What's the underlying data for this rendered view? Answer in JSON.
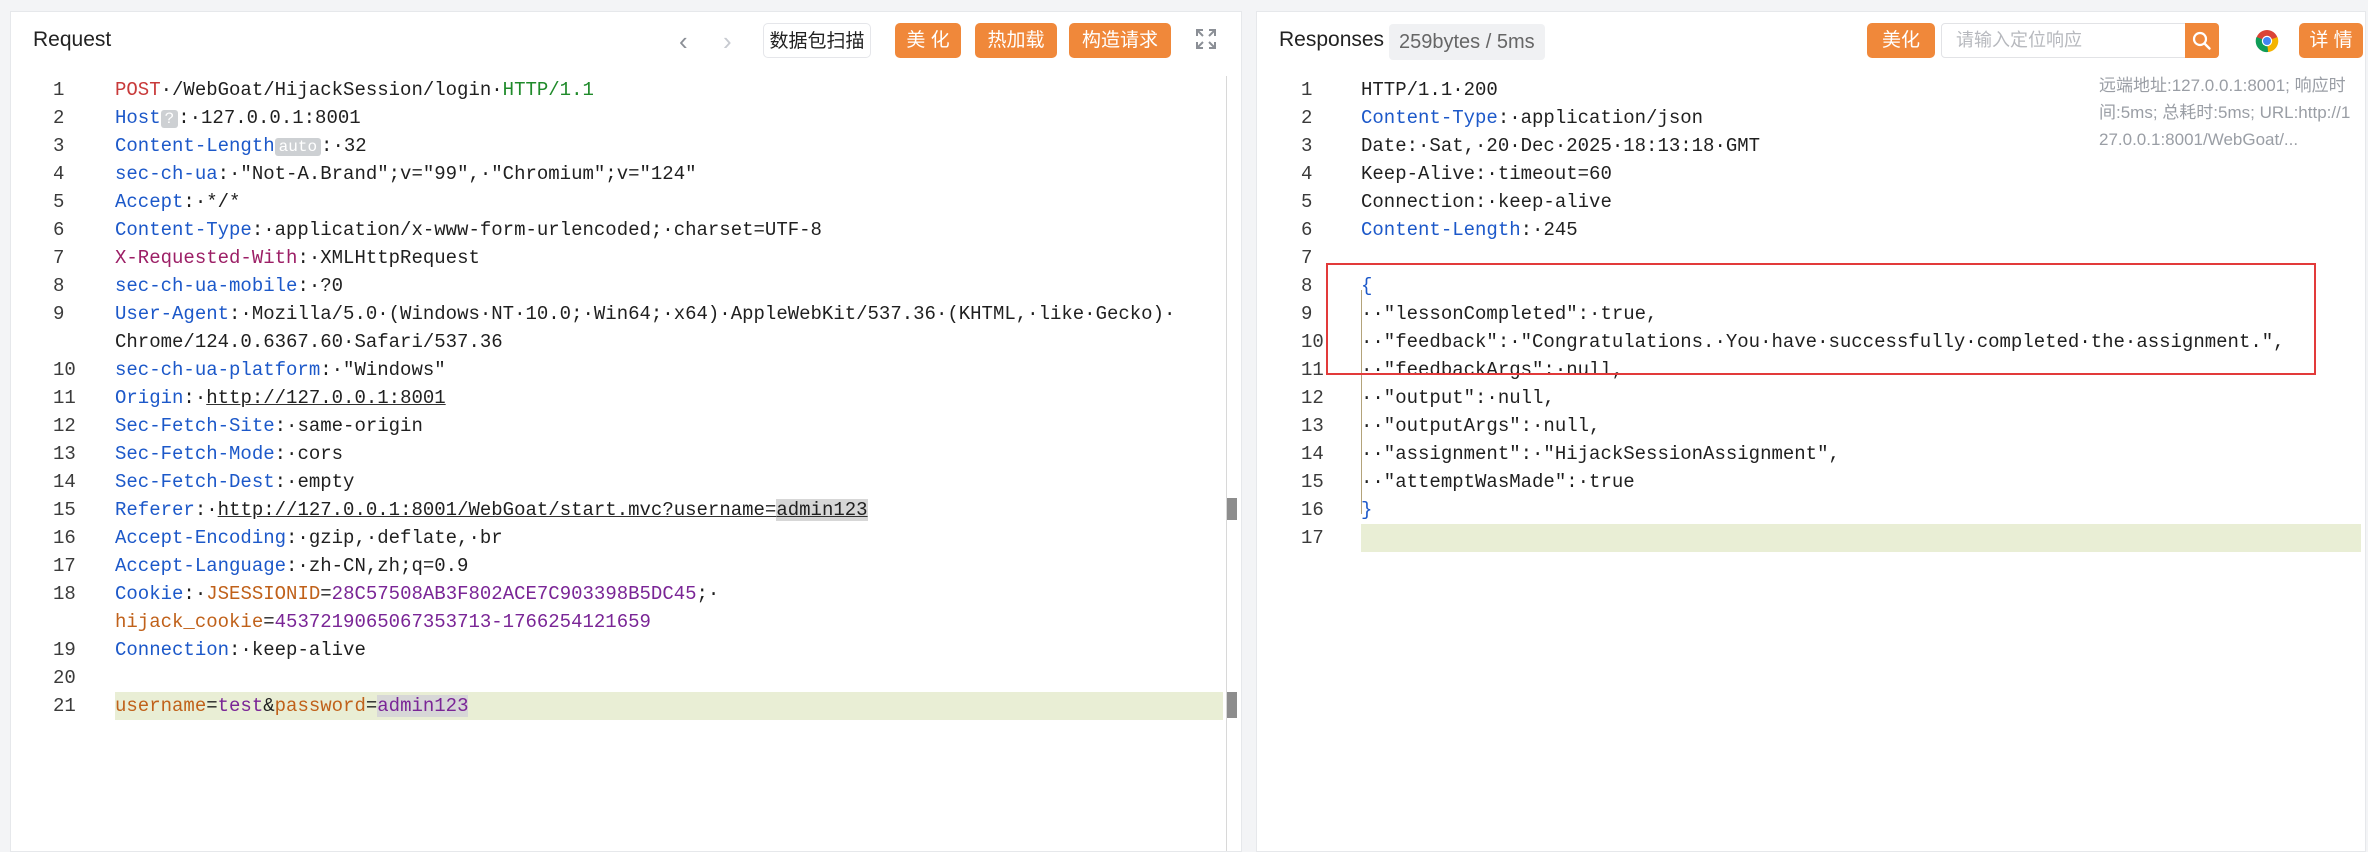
{
  "request": {
    "title": "Request",
    "scan_label": "数据包扫描",
    "beautify_label": "美 化",
    "hotload_label": "热加载",
    "construct_label": "构造请求",
    "lines": [
      {
        "n": "1",
        "parts": [
          [
            "k-red",
            "POST"
          ],
          [
            "",
            "·/WebGoat/HijackSession/login·"
          ],
          [
            "k-green",
            "HTTP/1.1"
          ]
        ]
      },
      {
        "n": "2",
        "parts": [
          [
            "k-blue",
            "Host"
          ],
          [
            "tag",
            "?"
          ],
          [
            "",
            ":·127.0.0.1:8001"
          ]
        ]
      },
      {
        "n": "3",
        "parts": [
          [
            "k-blue",
            "Content-Length"
          ],
          [
            "tag",
            "auto"
          ],
          [
            "",
            ":·32"
          ]
        ]
      },
      {
        "n": "4",
        "parts": [
          [
            "k-blue",
            "sec-ch-ua"
          ],
          [
            "",
            ":·\"Not-A.Brand\";v=\"99\",·\"Chromium\";v=\"124\""
          ]
        ]
      },
      {
        "n": "5",
        "parts": [
          [
            "k-blue",
            "Accept"
          ],
          [
            "",
            ":·*/*"
          ]
        ]
      },
      {
        "n": "6",
        "parts": [
          [
            "k-blue",
            "Content-Type"
          ],
          [
            "",
            ":·application/x-www-form-urlencoded;·charset=UTF-8"
          ]
        ]
      },
      {
        "n": "7",
        "parts": [
          [
            "k-pink",
            "X-Requested-With"
          ],
          [
            "",
            ":·XMLHttpRequest"
          ]
        ]
      },
      {
        "n": "8",
        "parts": [
          [
            "k-blue",
            "sec-ch-ua-mobile"
          ],
          [
            "",
            ":·?0"
          ]
        ]
      },
      {
        "n": "9",
        "parts": [
          [
            "k-blue",
            "User-Agent"
          ],
          [
            "",
            ":·Mozilla/5.0·(Windows·NT·10.0;·Win64;·x64)·AppleWebKit/537.36·(KHTML,·like·Gecko)·"
          ]
        ]
      },
      {
        "n": "",
        "parts": [
          [
            "",
            "Chrome/124.0.6367.60·Safari/537.36"
          ]
        ]
      },
      {
        "n": "10",
        "parts": [
          [
            "k-blue",
            "sec-ch-ua-platform"
          ],
          [
            "",
            ":·\"Windows\""
          ]
        ]
      },
      {
        "n": "11",
        "parts": [
          [
            "k-blue",
            "Origin"
          ],
          [
            "",
            ":·"
          ],
          [
            "ul",
            "http://127.0.0.1:8001"
          ]
        ]
      },
      {
        "n": "12",
        "parts": [
          [
            "k-blue",
            "Sec-Fetch-Site"
          ],
          [
            "",
            ":·same-origin"
          ]
        ]
      },
      {
        "n": "13",
        "parts": [
          [
            "k-blue",
            "Sec-Fetch-Mode"
          ],
          [
            "",
            ":·cors"
          ]
        ]
      },
      {
        "n": "14",
        "parts": [
          [
            "k-blue",
            "Sec-Fetch-Dest"
          ],
          [
            "",
            ":·empty"
          ]
        ]
      },
      {
        "n": "15",
        "parts": [
          [
            "k-blue",
            "Referer"
          ],
          [
            "",
            ":·"
          ],
          [
            "ul",
            "http://127.0.0.1:8001/WebGoat/start.mvc?username="
          ],
          [
            "ul sel",
            "admin123"
          ]
        ]
      },
      {
        "n": "16",
        "parts": [
          [
            "k-blue",
            "Accept-Encoding"
          ],
          [
            "",
            ":·gzip,·deflate,·br"
          ]
        ]
      },
      {
        "n": "17",
        "parts": [
          [
            "k-blue",
            "Accept-Language"
          ],
          [
            "",
            ":·zh-CN,zh;q=0.9"
          ]
        ]
      },
      {
        "n": "18",
        "parts": [
          [
            "k-blue",
            "Cookie"
          ],
          [
            "",
            ":·"
          ],
          [
            "k-orange",
            "JSESSIONID"
          ],
          [
            "",
            "="
          ],
          [
            "k-purple",
            "28C57508AB3F802ACE7C903398B5DC45"
          ],
          [
            "",
            ";·"
          ]
        ]
      },
      {
        "n": "",
        "parts": [
          [
            "k-orange",
            "hijack_cookie"
          ],
          [
            "",
            "="
          ],
          [
            "k-purple",
            "4537219065067353713-1766254121659"
          ]
        ]
      },
      {
        "n": "19",
        "parts": [
          [
            "k-blue",
            "Connection"
          ],
          [
            "",
            ":·keep-alive"
          ]
        ]
      },
      {
        "n": "20",
        "parts": []
      },
      {
        "n": "21",
        "hl": true,
        "parts": [
          [
            "k-orange",
            "username"
          ],
          [
            "",
            "="
          ],
          [
            "k-purple",
            "test"
          ],
          [
            "",
            "&"
          ],
          [
            "k-orange",
            "password"
          ],
          [
            "",
            "="
          ],
          [
            "k-purple sel",
            "admin123"
          ]
        ]
      }
    ]
  },
  "response": {
    "title": "Responses",
    "size_badge": "259bytes / 5ms",
    "beautify_label": "美化",
    "search_placeholder": "请输入定位响应",
    "details_label": "详 情",
    "meta_text": "远端地址:127.0.0.1:8001; 响应时间:5ms; 总耗时:5ms; URL:http://127.0.0.1:8001/WebGoat/...",
    "meta_lines": [
      "远端地址:127.0.0.1:8001; 响应时",
      "间:5ms; 总耗时:5ms; URL:http://1",
      "27.0.0.1:8001/WebGoat/..."
    ],
    "lines": [
      {
        "n": "1",
        "parts": [
          [
            "",
            "HTTP/1.1·200"
          ]
        ]
      },
      {
        "n": "2",
        "parts": [
          [
            "k-blue",
            "Content-Type"
          ],
          [
            "",
            ":·application/json"
          ]
        ]
      },
      {
        "n": "3",
        "parts": [
          [
            "",
            "Date:·Sat,·20·Dec·2025·18:13:18·GMT"
          ]
        ]
      },
      {
        "n": "4",
        "parts": [
          [
            "",
            "Keep-Alive:·timeout=60"
          ]
        ]
      },
      {
        "n": "5",
        "parts": [
          [
            "",
            "Connection:·keep-alive"
          ]
        ]
      },
      {
        "n": "6",
        "parts": [
          [
            "k-blue",
            "Content-Length"
          ],
          [
            "",
            ":·245"
          ]
        ]
      },
      {
        "n": "7",
        "parts": []
      },
      {
        "n": "8",
        "parts": [
          [
            "k-blue",
            "{"
          ]
        ]
      },
      {
        "n": "9",
        "parts": [
          [
            "",
            "··\"lessonCompleted\":·true,"
          ]
        ]
      },
      {
        "n": "10",
        "parts": [
          [
            "",
            "··\"feedback\":·\"Congratulations.·You·have·successfully·completed·the·assignment.\","
          ]
        ]
      },
      {
        "n": "11",
        "parts": [
          [
            "",
            "··\"feedbackArgs\":·null,"
          ]
        ]
      },
      {
        "n": "12",
        "parts": [
          [
            "",
            "··\"output\":·null,"
          ]
        ]
      },
      {
        "n": "13",
        "parts": [
          [
            "",
            "··\"outputArgs\":·null,"
          ]
        ]
      },
      {
        "n": "14",
        "parts": [
          [
            "",
            "··\"assignment\":·\"HijackSessionAssignment\","
          ]
        ]
      },
      {
        "n": "15",
        "parts": [
          [
            "",
            "··\"attemptWasMade\":·true"
          ]
        ]
      },
      {
        "n": "16",
        "parts": [
          [
            "k-blue",
            "}"
          ]
        ]
      },
      {
        "n": "17",
        "hl": true,
        "parts": []
      }
    ]
  },
  "icons": [
    "chevron-left-icon",
    "chevron-right-icon",
    "fullscreen-icon",
    "search-icon",
    "chrome-icon"
  ],
  "colors": {
    "accent": "#f0883a",
    "highlight_box": "#e23a3a",
    "line_highlight": "#e9eed5"
  }
}
